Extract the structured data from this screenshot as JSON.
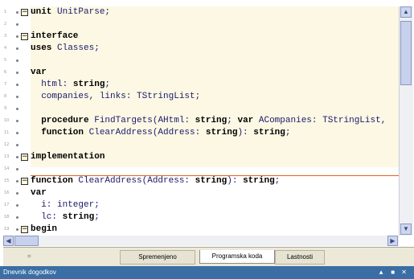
{
  "editor": {
    "lines": [
      {
        "num": "1",
        "fold": "minus",
        "segments": [
          {
            "t": "unit",
            "kw": true
          },
          {
            "t": " UnitParse;",
            "kw": false
          }
        ]
      },
      {
        "num": "2",
        "fold": "",
        "segments": []
      },
      {
        "num": "3",
        "fold": "minus",
        "segments": [
          {
            "t": "interface",
            "kw": true
          }
        ]
      },
      {
        "num": "4",
        "fold": "",
        "segments": [
          {
            "t": "uses",
            "kw": true
          },
          {
            "t": " Classes;",
            "kw": false
          }
        ]
      },
      {
        "num": "5",
        "fold": "",
        "segments": []
      },
      {
        "num": "6",
        "fold": "",
        "segments": [
          {
            "t": "var",
            "kw": true
          }
        ]
      },
      {
        "num": "7",
        "fold": "",
        "segments": [
          {
            "t": "  html: ",
            "kw": false
          },
          {
            "t": "string",
            "kw": true
          },
          {
            "t": ";",
            "kw": false
          }
        ]
      },
      {
        "num": "8",
        "fold": "",
        "segments": [
          {
            "t": "  companies, links: TStringList;",
            "kw": false
          }
        ]
      },
      {
        "num": "9",
        "fold": "",
        "segments": []
      },
      {
        "num": "10",
        "fold": "",
        "segments": [
          {
            "t": "  ",
            "kw": false
          },
          {
            "t": "procedure",
            "kw": true
          },
          {
            "t": " FindTargets(AHtml: ",
            "kw": false
          },
          {
            "t": "string",
            "kw": true
          },
          {
            "t": "; ",
            "kw": false
          },
          {
            "t": "var",
            "kw": true
          },
          {
            "t": " ACompanies: TStringList,",
            "kw": false
          }
        ]
      },
      {
        "num": "11",
        "fold": "",
        "segments": [
          {
            "t": "  ",
            "kw": false
          },
          {
            "t": "function",
            "kw": true
          },
          {
            "t": " ClearAddress(Address: ",
            "kw": false
          },
          {
            "t": "string",
            "kw": true
          },
          {
            "t": "): ",
            "kw": false
          },
          {
            "t": "string",
            "kw": true
          },
          {
            "t": ";",
            "kw": false
          }
        ]
      },
      {
        "num": "12",
        "fold": "",
        "segments": []
      },
      {
        "num": "13",
        "fold": "minus",
        "segments": [
          {
            "t": "implementation",
            "kw": true
          }
        ]
      },
      {
        "num": "14",
        "fold": "",
        "segments": []
      },
      {
        "num": "15",
        "fold": "minus",
        "segments": [
          {
            "t": "function",
            "kw": true
          },
          {
            "t": " ClearAddress(Address: ",
            "kw": false
          },
          {
            "t": "string",
            "kw": true
          },
          {
            "t": "): ",
            "kw": false
          },
          {
            "t": "string",
            "kw": true
          },
          {
            "t": ";",
            "kw": false
          }
        ]
      },
      {
        "num": "16",
        "fold": "",
        "segments": [
          {
            "t": "var",
            "kw": true
          }
        ]
      },
      {
        "num": "17",
        "fold": "",
        "segments": [
          {
            "t": "  i: integer;",
            "kw": false
          }
        ]
      },
      {
        "num": "18",
        "fold": "",
        "segments": [
          {
            "t": "  lc: ",
            "kw": false
          },
          {
            "t": "string",
            "kw": true
          },
          {
            "t": ";",
            "kw": false
          }
        ]
      },
      {
        "num": "19",
        "fold": "minus",
        "segments": [
          {
            "t": "begin",
            "kw": true
          }
        ]
      }
    ]
  },
  "tabs": {
    "eq": "=",
    "items": [
      {
        "label": "Spremenjeno",
        "active": false
      },
      {
        "label": "Programska koda",
        "active": true
      },
      {
        "label": "Lastnosti",
        "active": false
      }
    ]
  },
  "statusbar": {
    "title": "Dnevnik dogodkov",
    "icons": "▲ ■ ✕"
  },
  "colors": {
    "code_bg": "#fcf8e4",
    "separator": "#e0631a",
    "status_bg": "#3a6ea5"
  }
}
